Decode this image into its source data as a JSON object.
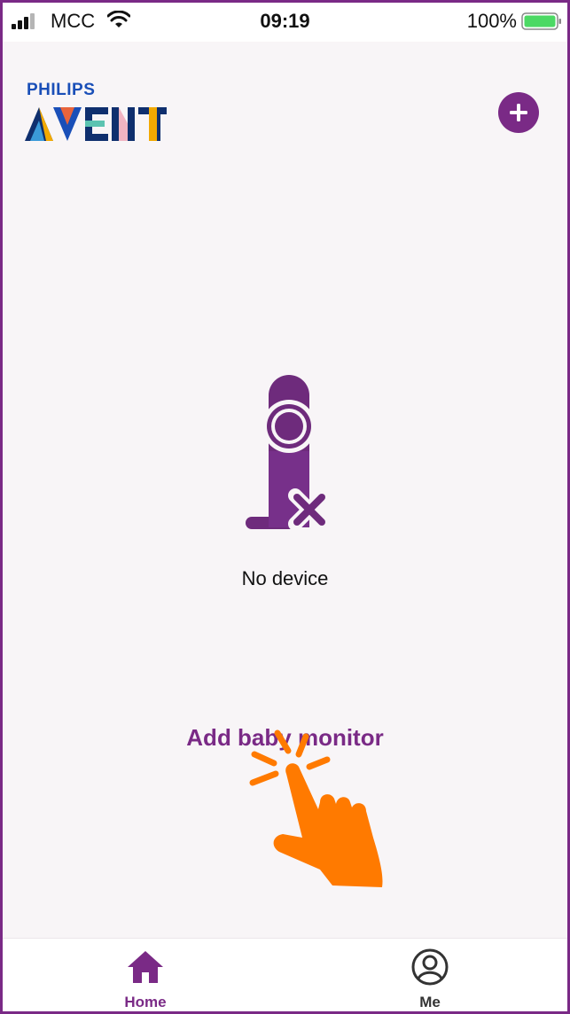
{
  "status_bar": {
    "carrier": "MCC",
    "time": "09:19",
    "battery_percent": "100%",
    "signal_icon": "cellular-signal-icon",
    "wifi_icon": "wifi-icon",
    "battery_icon": "battery-icon"
  },
  "header": {
    "brand_top": "PHILIPS",
    "brand_main": "AVENT",
    "add_icon": "plus-icon"
  },
  "empty_state": {
    "illustration_icon": "camera-no-device-icon",
    "message": "No device",
    "action_label": "Add baby monitor",
    "hint_icon": "tap-hand-icon"
  },
  "tab_bar": {
    "tabs": [
      {
        "label": "Home",
        "icon": "home-icon",
        "active": true
      },
      {
        "label": "Me",
        "icon": "user-profile-icon",
        "active": false
      }
    ]
  },
  "colors": {
    "accent": "#7a2a86",
    "background": "#f8f5f7",
    "hint": "#ff7a00",
    "philips_blue": "#1a4fb8"
  }
}
